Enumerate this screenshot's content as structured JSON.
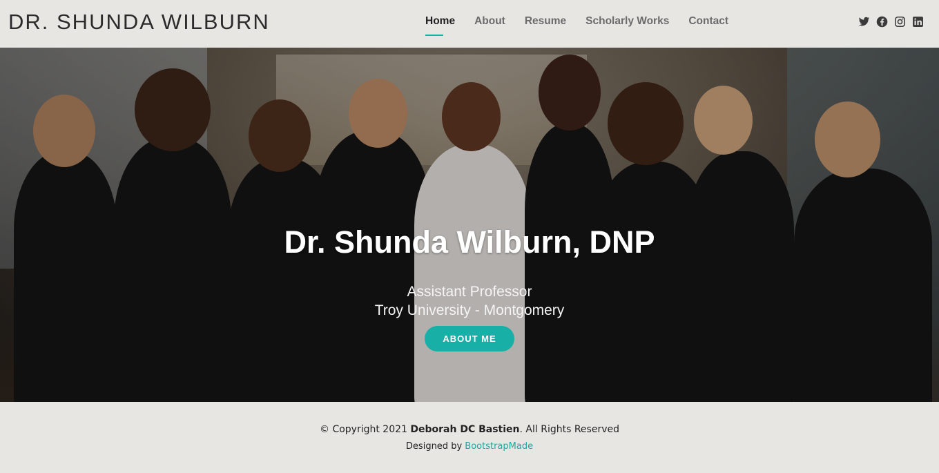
{
  "header": {
    "logo": "DR. SHUNDA WILBURN",
    "nav": [
      {
        "label": "Home",
        "active": true
      },
      {
        "label": "About",
        "active": false
      },
      {
        "label": "Resume",
        "active": false
      },
      {
        "label": "Scholarly Works",
        "active": false
      },
      {
        "label": "Contact",
        "active": false
      }
    ],
    "social": [
      "twitter-icon",
      "facebook-icon",
      "instagram-icon",
      "linkedin-icon"
    ]
  },
  "hero": {
    "title": "Dr. Shunda Wilburn, DNP",
    "subtitle_line1": "Assistant Professor",
    "subtitle_line2": "Troy University - Montgomery",
    "button_label": "ABOUT ME"
  },
  "footer": {
    "copyright_prefix": "© Copyright 2021 ",
    "copyright_name": "Deborah DC Bastien",
    "copyright_suffix": ". All Rights Reserved",
    "designed_by_prefix": "Designed by ",
    "designed_by_link": "BootstrapMade"
  },
  "colors": {
    "accent": "#18b0a6",
    "background": "#e8e6e3",
    "text": "#222222"
  }
}
